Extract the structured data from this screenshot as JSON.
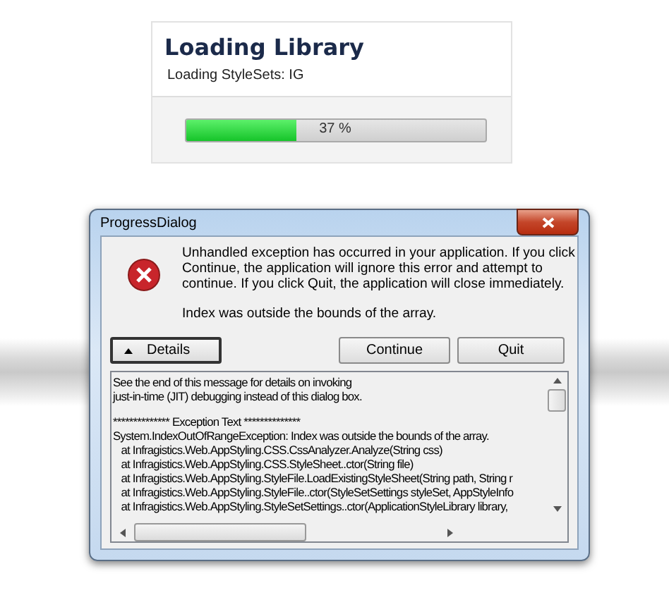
{
  "loading_panel": {
    "title": "Loading Library",
    "status": "Loading StyleSets: IG",
    "progress": {
      "level": 0.37,
      "label": "37 %"
    }
  },
  "dialog": {
    "title": "ProgressDialog",
    "message": "Unhandled exception has occurred in your application. If you click Continue, the application will ignore this error and attempt to continue. If you click Quit, the application will close immediately.",
    "detail": "Index was outside the bounds of the array.",
    "buttons": [
      {
        "label": "Details",
        "kind": "details",
        "expanded": true
      },
      {
        "label": "Continue",
        "kind": "push"
      },
      {
        "label": "Quit",
        "kind": "push"
      }
    ],
    "log_paragraphs": [
      {
        "lines": [
          "See the end of this message for details on invoking",
          "just-in-time (JIT) debugging instead of this dialog box."
        ]
      },
      {
        "lines": [
          "************** Exception Text **************",
          "System.IndexOutOfRangeException: Index was outside the bounds of the array.",
          "   at Infragistics.Web.AppStyling.CSS.CssAnalyzer.Analyze(String css)",
          "   at Infragistics.Web.AppStyling.CSS.StyleSheet..ctor(String file)",
          "   at Infragistics.Web.AppStyling.StyleFile.LoadExistingStyleSheet(String path, String r",
          "   at Infragistics.Web.AppStyling.StyleFile..ctor(StyleSetSettings styleSet, AppStyleInfo",
          "   at Infragistics.Web.AppStyling.StyleSetSettings..ctor(ApplicationStyleLibrary library,"
        ]
      }
    ]
  }
}
